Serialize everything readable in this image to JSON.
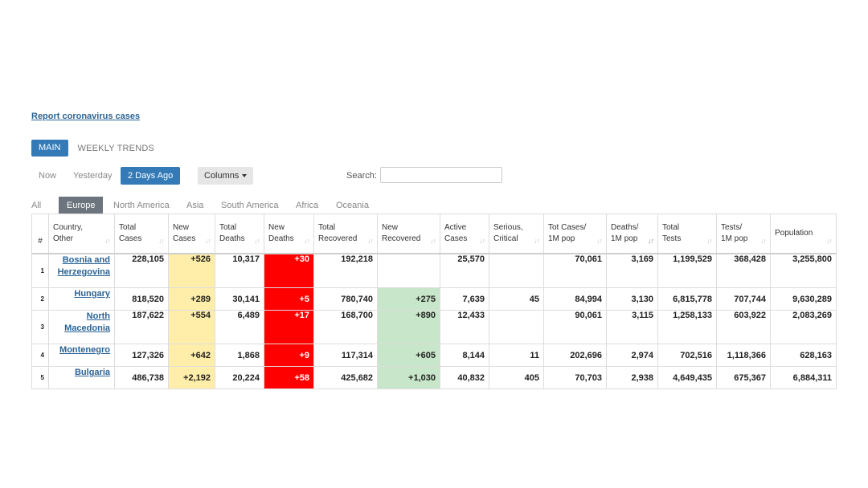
{
  "report_link": "Report coronavirus cases",
  "tabs": {
    "main": "MAIN",
    "weekly": "WEEKLY TRENDS"
  },
  "days": {
    "now": "Now",
    "yesterday": "Yesterday",
    "active": "2 Days Ago",
    "columns": "Columns"
  },
  "search": {
    "label": "Search:",
    "value": "",
    "placeholder": ""
  },
  "regions": [
    "All",
    "Europe",
    "North America",
    "Asia",
    "South America",
    "Africa",
    "Oceania"
  ],
  "active_region": "Europe",
  "columns": [
    "#",
    "Country,\nOther",
    "Total\nCases",
    "New\nCases",
    "Total\nDeaths",
    "New\nDeaths",
    "Total\nRecovered",
    "New\nRecovered",
    "Active\nCases",
    "Serious,\nCritical",
    "Tot Cases/\n1M pop",
    "Deaths/\n1M pop",
    "Total\nTests",
    "Tests/\n1M pop",
    "Population"
  ],
  "rows": [
    [
      "1",
      "Bosnia and Herzegovina",
      "228,105",
      "+526",
      "10,317",
      "+30",
      "192,218",
      "",
      "25,570",
      "",
      "70,061",
      "3,169",
      "1,199,529",
      "368,428",
      "3,255,800"
    ],
    [
      "2",
      "Hungary",
      "818,520",
      "+289",
      "30,141",
      "+5",
      "780,740",
      "+275",
      "7,639",
      "45",
      "84,994",
      "3,130",
      "6,815,778",
      "707,744",
      "9,630,289"
    ],
    [
      "3",
      "North Macedonia",
      "187,622",
      "+554",
      "6,489",
      "+17",
      "168,700",
      "+890",
      "12,433",
      "",
      "90,061",
      "3,115",
      "1,258,133",
      "603,922",
      "2,083,269"
    ],
    [
      "4",
      "Montenegro",
      "127,326",
      "+642",
      "1,868",
      "+9",
      "117,314",
      "+605",
      "8,144",
      "11",
      "202,696",
      "2,974",
      "702,516",
      "1,118,366",
      "628,163"
    ],
    [
      "5",
      "Bulgaria",
      "486,738",
      "+2,192",
      "20,224",
      "+58",
      "425,682",
      "+1,030",
      "40,832",
      "405",
      "70,703",
      "2,938",
      "4,649,435",
      "675,367",
      "6,884,311"
    ]
  ],
  "colors": {
    "accent": "#337ab7",
    "link": "#2a6496",
    "new_cases": "#ffeeaa",
    "new_deaths": "#ff0000",
    "new_recovered": "#c8e6c9",
    "region_active": "#6c757d"
  }
}
